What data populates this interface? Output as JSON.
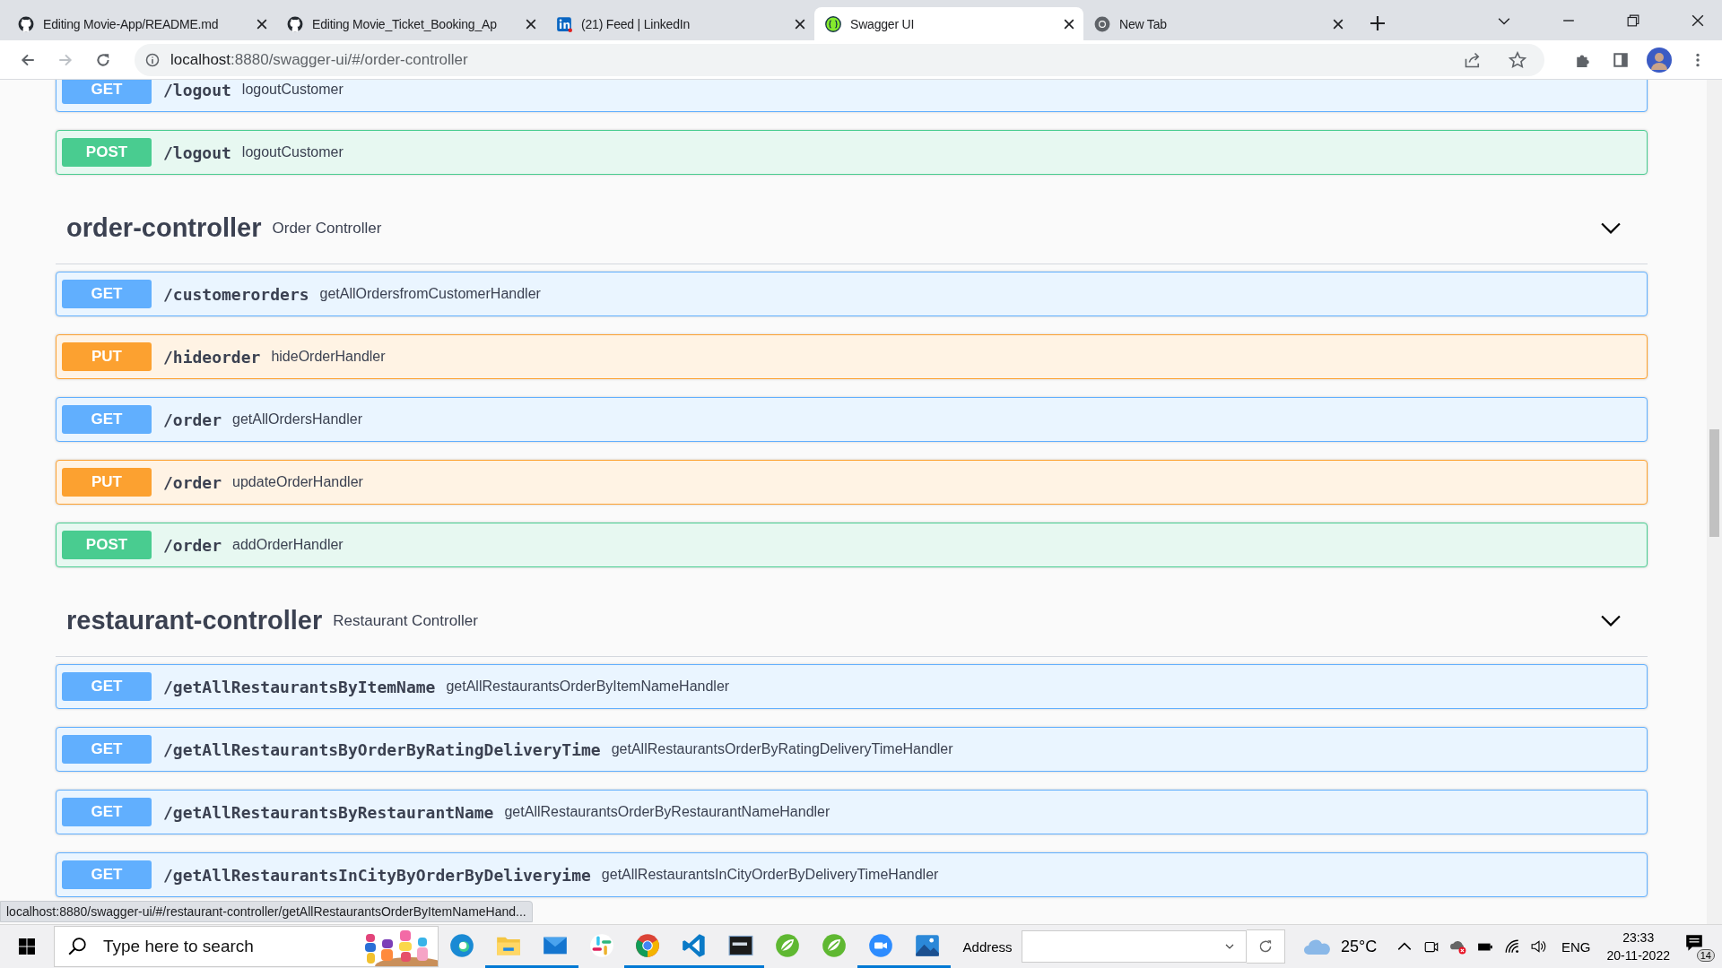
{
  "browser": {
    "tabs": [
      {
        "title": "Editing Movie-App/README.md",
        "selected": false
      },
      {
        "title": "Editing Movie_Ticket_Booking_Ap",
        "selected": false
      },
      {
        "title": "(21) Feed | LinkedIn",
        "selected": false
      },
      {
        "title": "Swagger UI",
        "selected": true
      },
      {
        "title": "New Tab",
        "selected": false
      }
    ],
    "address_host": "localhost",
    "address_rest": ":8880/swagger-ui/#/order-controller"
  },
  "sections": [
    {
      "endpoints": [
        {
          "method": "GET",
          "path": "/logout",
          "summary": "logoutCustomer",
          "color": "#61affe"
        },
        {
          "method": "POST",
          "path": "/logout",
          "summary": "logoutCustomer",
          "color": "#49cc90"
        }
      ]
    },
    {
      "name": "order-controller",
      "description": "Order Controller",
      "expanded": true,
      "endpoints": [
        {
          "method": "GET",
          "path": "/customerorders",
          "summary": "getAllOrdersfromCustomerHandler",
          "color": "#61affe"
        },
        {
          "method": "PUT",
          "path": "/hideorder",
          "summary": "hideOrderHandler",
          "color": "#fca130"
        },
        {
          "method": "GET",
          "path": "/order",
          "summary": "getAllOrdersHandler",
          "color": "#61affe"
        },
        {
          "method": "PUT",
          "path": "/order",
          "summary": "updateOrderHandler",
          "color": "#fca130"
        },
        {
          "method": "POST",
          "path": "/order",
          "summary": "addOrderHandler",
          "color": "#49cc90"
        }
      ]
    },
    {
      "name": "restaurant-controller",
      "description": "Restaurant Controller",
      "expanded": true,
      "endpoints": [
        {
          "method": "GET",
          "path": "/getAllRestaurantsByItemName",
          "summary": "getAllRestaurantsOrderByItemNameHandler",
          "color": "#61affe"
        },
        {
          "method": "GET",
          "path": "/getAllRestaurantsByOrderByRatingDeliveryTime",
          "summary": "getAllRestaurantsOrderByRatingDeliveryTimeHandler",
          "color": "#61affe"
        },
        {
          "method": "GET",
          "path": "/getAllRestaurantsByRestaurantName",
          "summary": "getAllRestaurantsOrderByRestaurantNameHandler",
          "color": "#61affe"
        },
        {
          "method": "GET",
          "path": "/getAllRestaurantsInCityByOrderByDeliveryime",
          "summary": "getAllRestaurantsInCityOrderByDeliveryTimeHandler",
          "color": "#61affe"
        }
      ]
    }
  ],
  "status_link": "localhost:8880/swagger-ui/#/restaurant-controller/getAllRestaurantsOrderByItemNameHand...",
  "taskbar": {
    "search_placeholder": "Type here to search",
    "apps": [
      {
        "kind": "edge",
        "running": false
      },
      {
        "kind": "folder",
        "running": true
      },
      {
        "kind": "mail",
        "running": true
      },
      {
        "kind": "slack",
        "running": false
      },
      {
        "kind": "chrome",
        "running": true
      },
      {
        "kind": "vscode",
        "running": true
      },
      {
        "kind": "terminal",
        "running": true
      },
      {
        "kind": "leaf",
        "running": false
      },
      {
        "kind": "leaf",
        "running": false
      },
      {
        "kind": "video",
        "running": true
      },
      {
        "kind": "photos",
        "running": true
      }
    ],
    "address_label": "Address",
    "temperature": "25°C",
    "language": "ENG",
    "time": "23:33",
    "date": "20-11-2022",
    "notifications": "14"
  }
}
